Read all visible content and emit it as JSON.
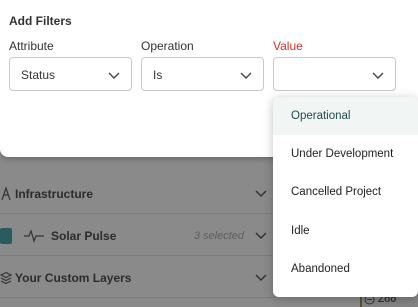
{
  "filters": {
    "title": "Add Filters",
    "attribute": {
      "label": "Attribute",
      "value": "Status"
    },
    "operation": {
      "label": "Operation",
      "value": "Is"
    },
    "value": {
      "label": "Value",
      "value": ""
    },
    "dropdown_options": [
      "Operational",
      "Under Development",
      "Cancelled Project",
      "Idle",
      "Abandoned"
    ],
    "highlighted_option": "Operational"
  },
  "layers": {
    "rows": [
      {
        "label": "Infrastructure"
      },
      {
        "label": "Solar Pulse",
        "selected_count": "3 selected"
      },
      {
        "label": "Your Custom Layers"
      }
    ]
  },
  "map_controls": {
    "zoom_label": "Zoo"
  },
  "colors": {
    "accent_required": "#d0312d",
    "highlight_bg": "#f1f5f4",
    "checkbox": "#2a5b5e"
  }
}
